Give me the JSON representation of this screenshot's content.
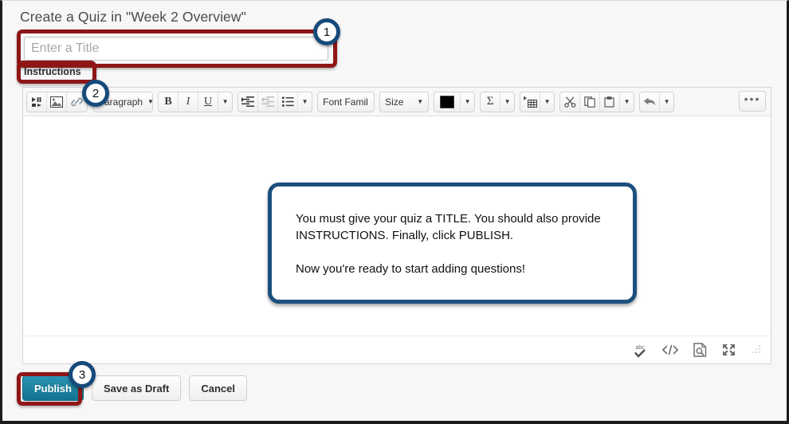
{
  "header": {
    "title": "Create a Quiz in \"Week 2 Overview\""
  },
  "title_field": {
    "placeholder": "Enter a Title",
    "value": ""
  },
  "instructions": {
    "label": "Instructions"
  },
  "badges": {
    "one": "1",
    "two": "2",
    "three": "3"
  },
  "toolbar": {
    "media_icon": "media-icon",
    "image_icon": "image-icon",
    "link_icon": "link-icon",
    "paragraph_select": "Paragraph",
    "bold_label": "B",
    "italic_label": "I",
    "underline_label": "U",
    "format_caret": "▼",
    "indent_icon": "indent-icon",
    "outdent_icon": "outdent-icon",
    "bullet_list_icon": "bullet-list-icon",
    "list_caret": "▼",
    "font_family_select": "Font Famil",
    "font_size_select": "Size",
    "text_color": "#000000",
    "color_caret": "▼",
    "equation_label": "Σ",
    "equation_caret": "▼",
    "table_icon": "insert-table-icon",
    "table_caret": "▼",
    "cut_icon": "scissors-icon",
    "copy_icon": "copy-icon",
    "paste_icon": "paste-icon",
    "paste_caret": "▼",
    "undo_icon": "undo-arrow-icon",
    "undo_caret": "▼",
    "more_label": "•••"
  },
  "editor_status": {
    "spellcheck_icon": "spellcheck-abc-icon",
    "html_icon": "html-code-icon",
    "preview_icon": "preview-document-icon",
    "fullscreen_icon": "fullscreen-icon",
    "resize_grip_icon": "resize-grip-icon"
  },
  "callout": {
    "line1": "You must give your quiz a TITLE. You should also provide INSTRUCTIONS. Finally, click PUBLISH.",
    "line2": "Now you're ready to start adding questions!",
    "border_color": "#1b4f7e"
  },
  "footer": {
    "publish_label": "Publish",
    "save_draft_label": "Save as Draft",
    "cancel_label": "Cancel"
  },
  "colors": {
    "highlight_red": "#8f1616",
    "badge_ring": "#164a7b",
    "publish_teal": "#12738f"
  }
}
